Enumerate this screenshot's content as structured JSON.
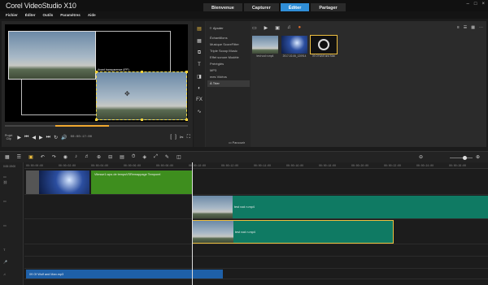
{
  "app": {
    "title": "Corel VideoStudio X10"
  },
  "workspace_tabs": [
    "Bienvenue",
    "Capturer",
    "Éditer",
    "Partager"
  ],
  "window_controls": [
    "–",
    "□",
    "×"
  ],
  "menu": [
    "Fichier",
    "Éditer",
    "Outils",
    "Paramètres",
    "Aide"
  ],
  "player": {
    "caption": "Avant transparence (iPF)",
    "mode_project": "Projet",
    "mode_clip": "Clip",
    "timecode": "00:00:17:00"
  },
  "library": {
    "add_label": "Ajouter",
    "folders": [
      "Échantillons",
      "Musique ScoreFitter",
      "Triple Scoop Music",
      "Effet sonore Modèle",
      "Préréglés",
      "MP3",
      "mes Vidéos",
      "À Trier"
    ],
    "active_folder": "À Trier",
    "browse_label": "Parcourir",
    "items": [
      {
        "caption": "test vod n.mp4",
        "kind": "sky",
        "selected": false
      },
      {
        "caption": "2017-02-06_120914",
        "kind": "night",
        "selected": false
      },
      {
        "caption": "09 Of Wolf and Man",
        "kind": "audio",
        "selected": true
      }
    ]
  },
  "timeline": {
    "ruler_ticks": [
      "00:00:00:00",
      "00:00:02:00",
      "00:00:04:00",
      "00:00:06:00",
      "00:00:08:00",
      "00:00:10:00",
      "00:00:12:00",
      "00:00:14:00",
      "00:00:16:00",
      "00:00:18:00",
      "00:00:20:00",
      "00:00:22:00",
      "00:00:24:00",
      "00:00:26:00"
    ],
    "video_title_clip": "Vitesse1.wps de tempsVSRemappage Temporel",
    "overlay_clip_1": "test vod n.mp4",
    "overlay_clip_2": "test vod n.mp4",
    "music_clip": "09 Of Wolf and Man.mp3",
    "project_duration": "0:00:19:00"
  },
  "colors": {
    "accent": "#2f8ed8",
    "video_clip": "#3e8e1e",
    "overlay_clip": "#0f7a63",
    "music_clip": "#1e60a8",
    "selection": "#f0c040"
  }
}
